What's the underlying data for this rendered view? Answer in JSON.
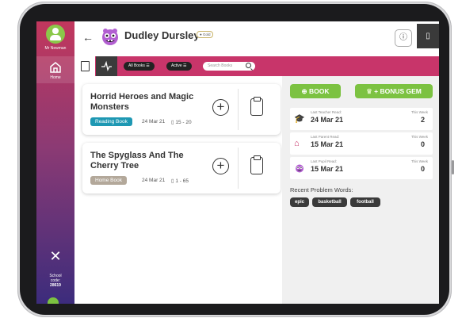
{
  "sidebar": {
    "teacher_name": "Mr Newman",
    "home_label": "Home",
    "school_label": "School",
    "code_label": "code:",
    "school_code": "28619"
  },
  "header": {
    "pupil_name": "Dudley Dursley",
    "badge": "Gold"
  },
  "toolbar": {
    "filter_books": "All Books",
    "filter_status": "Active",
    "search_placeholder": "Search Books"
  },
  "books": [
    {
      "title": "Horrid Heroes and Magic Monsters",
      "tag": "Reading Book",
      "tag_color": "#1e98b3",
      "date": "24 Mar 21",
      "pages": "15 - 20"
    },
    {
      "title": "The Spyglass And The Cherry Tree",
      "tag": "Home Book",
      "tag_color": "#b3a89a",
      "date": "24 Mar 21",
      "pages": "1 - 65"
    }
  ],
  "panel": {
    "book_button": "BOOK",
    "bonus_button": "+ BONUS GEM",
    "stats": [
      {
        "label": "Last Teacher Read:",
        "date": "24 Mar 21",
        "week_label": "This Week",
        "count": "2",
        "icon": "graduation-cap-icon"
      },
      {
        "label": "Last Parent Read:",
        "date": "15 Mar 21",
        "week_label": "This Week",
        "count": "0",
        "icon": "house-icon"
      },
      {
        "label": "Last Pupil Read:",
        "date": "15 Mar 21",
        "week_label": "This Week",
        "count": "0",
        "icon": "monster-icon"
      }
    ],
    "problem_words_title": "Recent Problem Words:",
    "problem_words": [
      "epic",
      "basketball",
      "football"
    ]
  },
  "colors": {
    "brand": "#c8356a",
    "green": "#7cc241"
  }
}
